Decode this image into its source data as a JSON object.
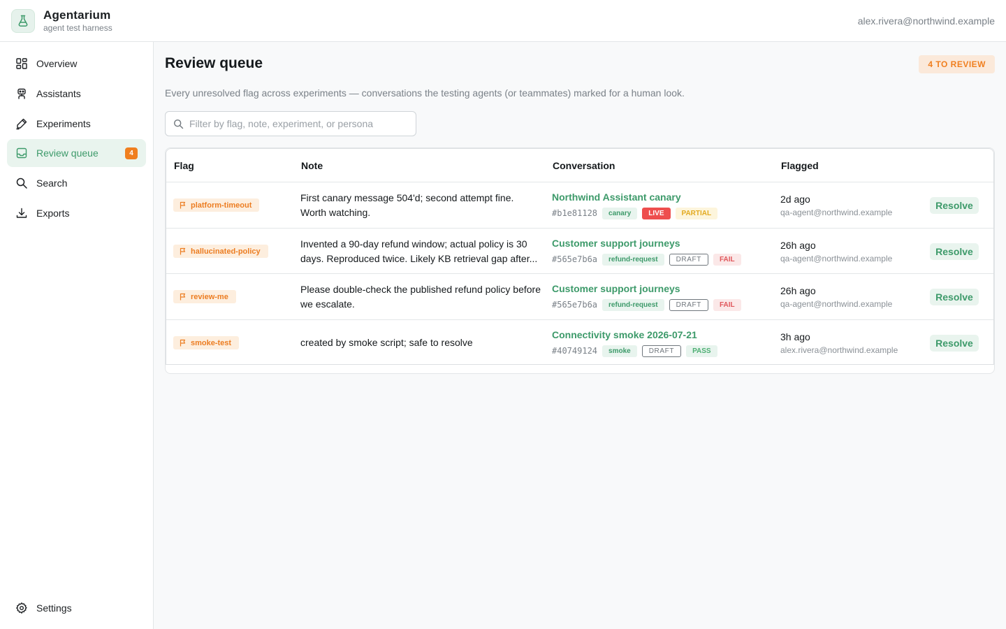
{
  "app": {
    "title": "Agentarium",
    "subtitle": "agent test harness",
    "user_email": "alex.rivera@northwind.example"
  },
  "sidebar": {
    "items": [
      {
        "label": "Overview",
        "icon": "dashboard-icon"
      },
      {
        "label": "Assistants",
        "icon": "robot-icon"
      },
      {
        "label": "Experiments",
        "icon": "flask-pen-icon"
      },
      {
        "label": "Review queue",
        "icon": "inbox-icon",
        "badge": "4",
        "active": true
      },
      {
        "label": "Search",
        "icon": "search-icon"
      },
      {
        "label": "Exports",
        "icon": "download-icon"
      }
    ],
    "settings_label": "Settings"
  },
  "page": {
    "title": "Review queue",
    "review_count": "4 TO REVIEW",
    "description": "Every unresolved flag across experiments — conversations the testing agents (or teammates) marked for a human look.",
    "search_placeholder": "Filter by flag, note, experiment, or persona"
  },
  "table": {
    "headers": {
      "flag": "Flag",
      "note": "Note",
      "conversation": "Conversation",
      "flagged": "Flagged"
    },
    "resolve_label": "Resolve",
    "rows": [
      {
        "flag": "platform-timeout",
        "note": "First canary message 504'd; second attempt fine. Worth watching.",
        "conversation": "Northwind Assistant canary",
        "conv_id": "#b1e81128",
        "tag": "canary",
        "status": "LIVE",
        "result": "PARTIAL",
        "flagged_time": "2d ago",
        "flagged_by": "qa-agent@northwind.example"
      },
      {
        "flag": "hallucinated-policy",
        "note": "Invented a 90-day refund window; actual policy is 30 days. Reproduced twice. Likely KB retrieval gap after...",
        "conversation": "Customer support journeys",
        "conv_id": "#565e7b6a",
        "tag": "refund-request",
        "status": "DRAFT",
        "result": "FAIL",
        "flagged_time": "26h ago",
        "flagged_by": "qa-agent@northwind.example"
      },
      {
        "flag": "review-me",
        "note": "Please double-check the published refund policy before we escalate.",
        "conversation": "Customer support journeys",
        "conv_id": "#565e7b6a",
        "tag": "refund-request",
        "status": "DRAFT",
        "result": "FAIL",
        "flagged_time": "26h ago",
        "flagged_by": "qa-agent@northwind.example"
      },
      {
        "flag": "smoke-test",
        "note": "created by smoke script; safe to resolve",
        "conversation": "Connectivity smoke 2026-07-21",
        "conv_id": "#40749124",
        "tag": "smoke",
        "status": "DRAFT",
        "result": "PASS",
        "flagged_time": "3h ago",
        "flagged_by": "alex.rivera@northwind.example"
      }
    ]
  },
  "colors": {
    "accent": "#3d9a6a",
    "flag_orange": "#ec7d22",
    "live_red": "#ee4e4e",
    "partial_yellow": "#e3aa20",
    "fail_red": "#e0575b",
    "pass_green": "#4cae72"
  }
}
